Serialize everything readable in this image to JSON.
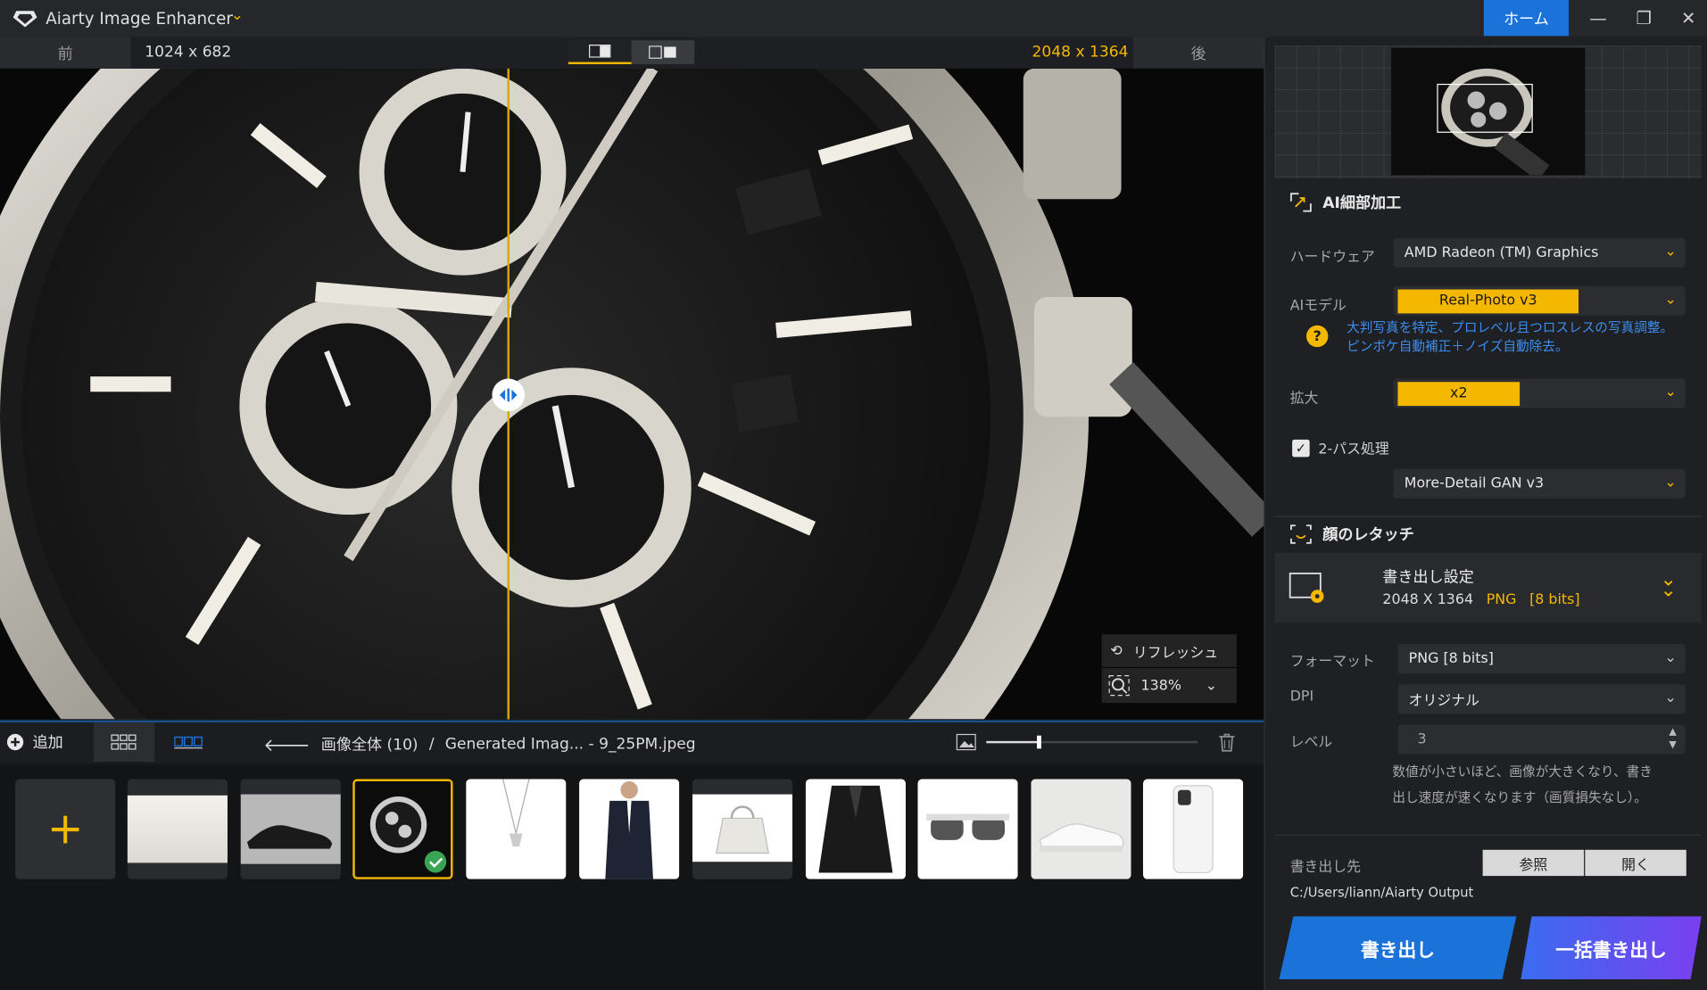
{
  "app": {
    "title": "Aiarty Image Enhancer",
    "home_label": "ホーム"
  },
  "compare": {
    "prev_label": "前",
    "source_resolution": "1024 x 682",
    "output_resolution": "2048 x 1364",
    "next_label": "後"
  },
  "preview": {
    "refresh_label": "リフレッシュ",
    "zoom": "138%"
  },
  "toolbar": {
    "add_label": "追加",
    "breadcrumb_all": "画像全体 (10)",
    "breadcrumb_sep": "/",
    "breadcrumb_file": "Generated Imag... - 9_25PM.jpeg",
    "thumb_zoom_percent": 25
  },
  "thumbnails": [
    "blank",
    "shoes",
    "watch",
    "necklace",
    "suit",
    "handbag",
    "jacket",
    "sunglasses",
    "sneaker",
    "phone-case"
  ],
  "panel": {
    "ai_section_title": "AI細部加工",
    "hardware_label": "ハードウェア",
    "hardware_value": "AMD Radeon (TM) Graphics",
    "ai_model_label": "AIモデル",
    "ai_model_value": "Real-Photo  v3",
    "ai_model_hint_1": "大判写真を特定、プロレベル且つロスレスの写真調整。",
    "ai_model_hint_2": "ピンボケ自動補正＋ノイズ自動除去。",
    "scale_label": "拡大",
    "scale_value": "x2",
    "two_pass_label": "2-パス処理",
    "two_pass_model": "More-Detail GAN  v3",
    "face_section_title": "顔のレタッチ",
    "export_title": "書き出し設定",
    "export_res": "2048 X 1364",
    "export_fmt": "PNG",
    "export_bits": "[8 bits]",
    "format_label": "フォーマット",
    "format_value": "PNG   [8 bits]",
    "dpi_label": "DPI",
    "dpi_value": "オリジナル",
    "level_label": "レベル",
    "level_value": "3",
    "level_hint_1": "数値が小さいほど、画像が大きくなり、書き",
    "level_hint_2": "出し速度が速くなります（画質損失なし）。",
    "dest_label": "書き出し先",
    "browse_label": "参照",
    "open_label": "開く",
    "dest_path": "C:/Users/liann/Aiarty Output",
    "export_btn": "書き出し",
    "batch_export_btn": "一括書き出し"
  },
  "colors": {
    "accent": "#f5b800",
    "blue": "#1b73d9",
    "purple": "#6b3cf0"
  }
}
